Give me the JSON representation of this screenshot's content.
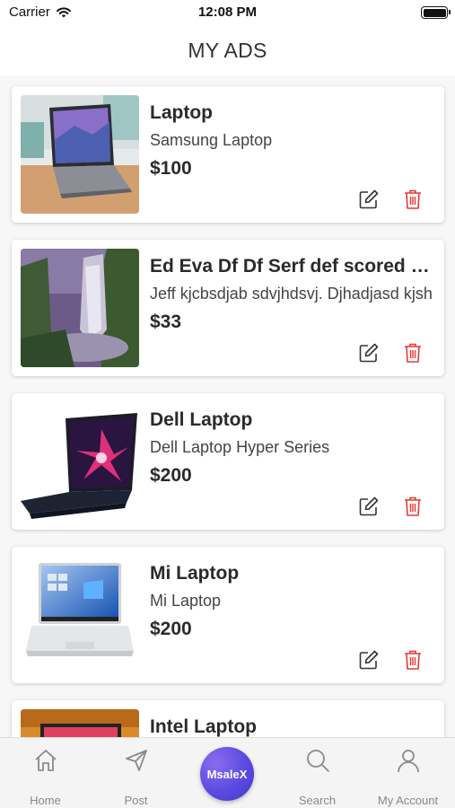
{
  "status_bar": {
    "carrier": "Carrier",
    "time": "12:08 PM"
  },
  "header": {
    "title": "MY ADS"
  },
  "ads": [
    {
      "title": "Laptop",
      "description": "Samsung Laptop",
      "price": "$100",
      "image": "laptop-on-desk-photo"
    },
    {
      "title": "Ed Eva Df Df Serf def scored dkjc",
      "description": "Jeff kjcbsdjab sdvjhdsvj. Djhadjasd kjsh",
      "price": "$33",
      "image": "waterfall-photo"
    },
    {
      "title": "Dell Laptop",
      "description": "Dell Laptop Hyper Series",
      "price": "$200",
      "image": "gaming-laptop-photo"
    },
    {
      "title": "Mi Laptop",
      "description": "Mi Laptop",
      "price": "$200",
      "image": "silver-laptop-photo"
    },
    {
      "title": "Intel Laptop",
      "description": "",
      "price": "",
      "image": "laptop-orange-photo"
    }
  ],
  "actions": {
    "edit_icon": "edit-icon",
    "delete_icon": "trash-icon",
    "delete_color": "#e53935"
  },
  "tabbar": {
    "home": "Home",
    "post": "Post",
    "center": "MsaleX",
    "search": "Search",
    "account": "My Account"
  }
}
